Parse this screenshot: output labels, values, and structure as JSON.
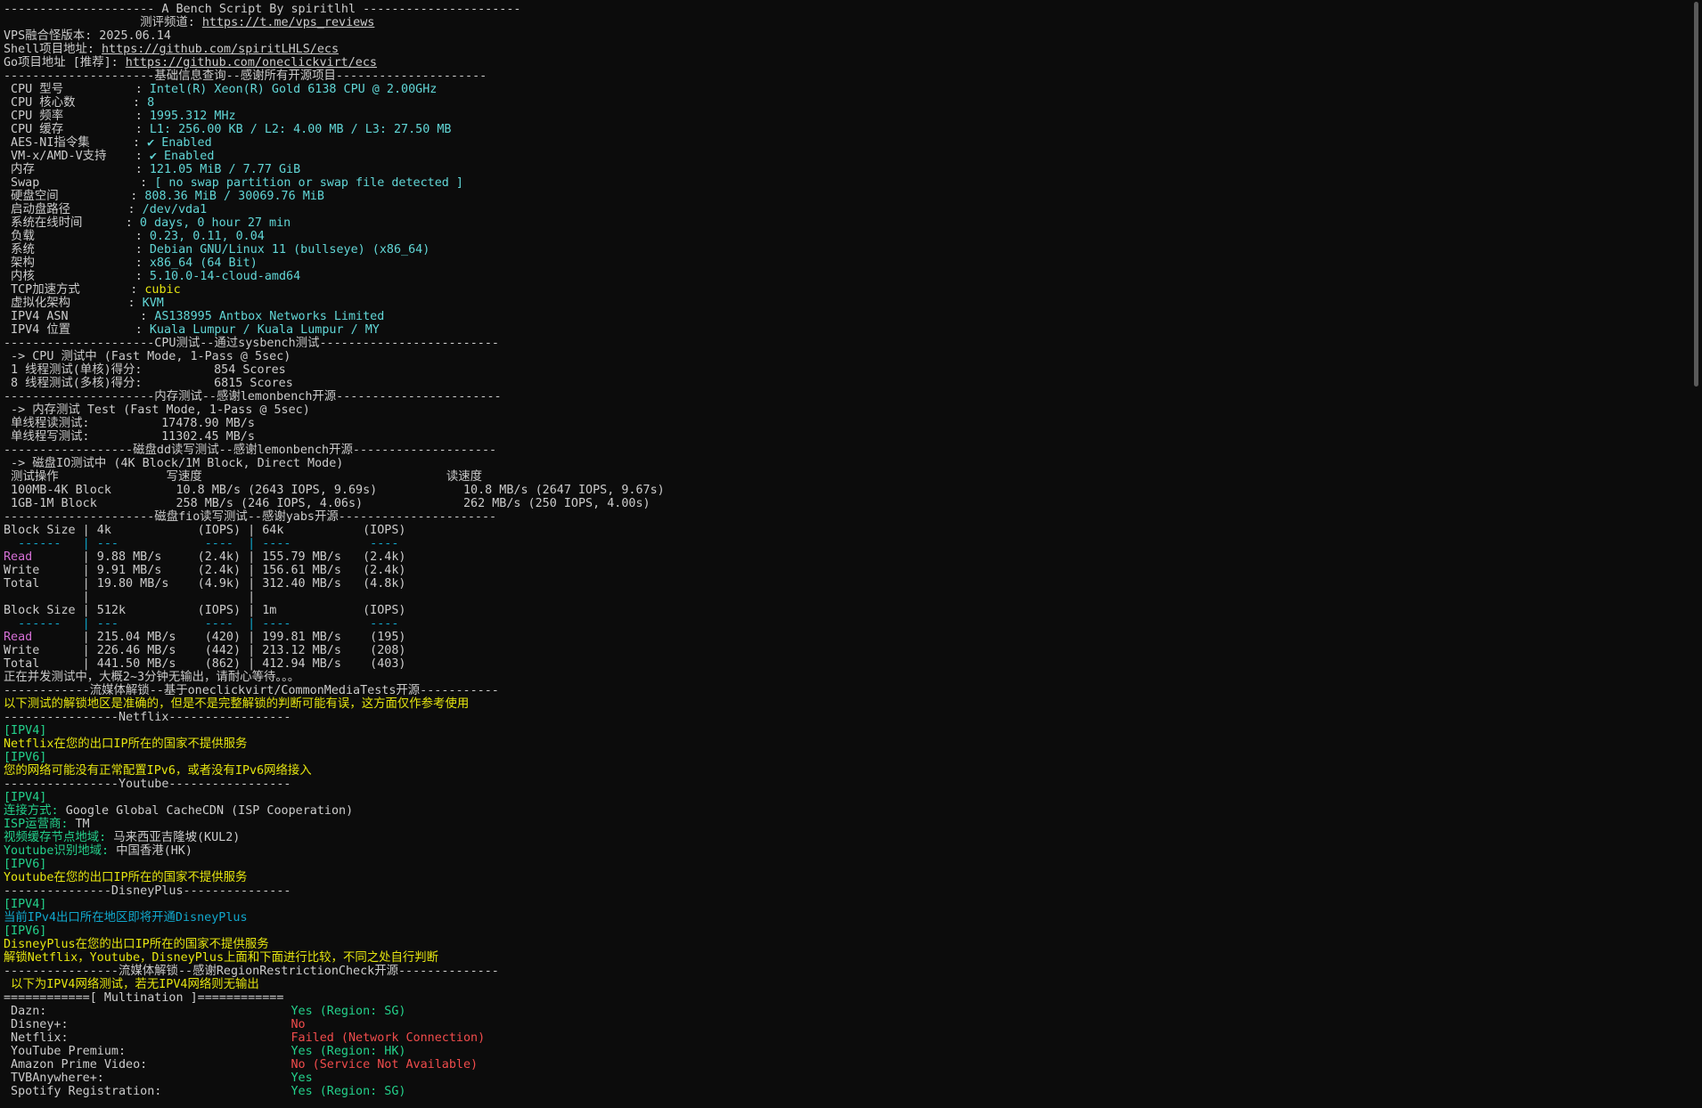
{
  "terminal": {
    "lines": [
      [
        [
          "default",
          "--------------------- A Bench Script By spiritlhl ----------------------"
        ]
      ],
      [
        [
          "default",
          "                   测评频道: "
        ],
        [
          "link",
          "https://t.me/vps_reviews"
        ]
      ],
      [
        [
          "default",
          "VPS融合怪版本: 2025.06.14"
        ]
      ],
      [
        [
          "default",
          "Shell项目地址: "
        ],
        [
          "link",
          "https://github.com/spiritLHLS/ecs"
        ]
      ],
      [
        [
          "default",
          "Go项目地址 [推荐]: "
        ],
        [
          "link",
          "https://github.com/oneclickvirt/ecs"
        ]
      ],
      [
        [
          "default",
          "---------------------基础信息查询--感谢所有开源项目---------------------"
        ]
      ],
      [
        [
          "default",
          " CPU 型号          : "
        ],
        [
          "cyan",
          "Intel(R) Xeon(R) Gold 6138 CPU @ 2.00GHz"
        ]
      ],
      [
        [
          "default",
          " CPU 核心数        : "
        ],
        [
          "cyan",
          "8"
        ]
      ],
      [
        [
          "default",
          " CPU 频率          : "
        ],
        [
          "cyan",
          "1995.312 MHz"
        ]
      ],
      [
        [
          "default",
          " CPU 缓存          : "
        ],
        [
          "cyan",
          "L1: 256.00 KB / L2: 4.00 MB / L3: 27.50 MB"
        ]
      ],
      [
        [
          "default",
          " AES-NI指令集      : "
        ],
        [
          "cyan",
          "✔ Enabled"
        ]
      ],
      [
        [
          "default",
          " VM-x/AMD-V支持    : "
        ],
        [
          "cyan",
          "✔ Enabled"
        ]
      ],
      [
        [
          "default",
          " 内存              : "
        ],
        [
          "cyan",
          "121.05 MiB / 7.77 GiB"
        ]
      ],
      [
        [
          "default",
          " Swap              : "
        ],
        [
          "cyan",
          "[ no swap partition or swap file detected ]"
        ]
      ],
      [
        [
          "default",
          " 硬盘空间          : "
        ],
        [
          "cyan",
          "808.36 MiB / 30069.76 MiB"
        ]
      ],
      [
        [
          "default",
          " 启动盘路径        : "
        ],
        [
          "cyan",
          "/dev/vda1"
        ]
      ],
      [
        [
          "default",
          " 系统在线时间      : "
        ],
        [
          "cyan",
          "0 days, 0 hour 27 min"
        ]
      ],
      [
        [
          "default",
          " 负载              : "
        ],
        [
          "cyan",
          "0.23, 0.11, 0.04"
        ]
      ],
      [
        [
          "default",
          " 系统              : "
        ],
        [
          "cyan",
          "Debian GNU/Linux 11 (bullseye) (x86_64)"
        ]
      ],
      [
        [
          "default",
          " 架构              : "
        ],
        [
          "cyan",
          "x86_64 (64 Bit)"
        ]
      ],
      [
        [
          "default",
          " 内核              : "
        ],
        [
          "cyan",
          "5.10.0-14-cloud-amd64"
        ]
      ],
      [
        [
          "default",
          " TCP加速方式       : "
        ],
        [
          "yellow",
          "cubic"
        ]
      ],
      [
        [
          "default",
          " 虚拟化架构        : "
        ],
        [
          "cyan",
          "KVM"
        ]
      ],
      [
        [
          "default",
          " IPV4 ASN          : "
        ],
        [
          "cyan",
          "AS138995 Antbox Networks Limited"
        ]
      ],
      [
        [
          "default",
          " IPV4 位置         : "
        ],
        [
          "cyan",
          "Kuala Lumpur / Kuala Lumpur / MY"
        ]
      ],
      [
        [
          "default",
          "---------------------CPU测试--通过sysbench测试-------------------------"
        ]
      ],
      [
        [
          "default",
          " -> CPU 测试中 (Fast Mode, 1-Pass @ 5sec)"
        ]
      ],
      [
        [
          "default",
          " 1 线程测试(单核)得分:          854 Scores"
        ]
      ],
      [
        [
          "default",
          " 8 线程测试(多核)得分:          6815 Scores"
        ]
      ],
      [
        [
          "default",
          "---------------------内存测试--感谢lemonbench开源-----------------------"
        ]
      ],
      [
        [
          "default",
          " -> 内存测试 Test (Fast Mode, 1-Pass @ 5sec)"
        ]
      ],
      [
        [
          "default",
          " 单线程读测试:          17478.90 MB/s"
        ]
      ],
      [
        [
          "default",
          " 单线程写测试:          11302.45 MB/s"
        ]
      ],
      [
        [
          "default",
          "------------------磁盘dd读写测试--感谢lemonbench开源--------------------"
        ]
      ],
      [
        [
          "default",
          " -> 磁盘IO测试中 (4K Block/1M Block, Direct Mode)"
        ]
      ],
      [
        [
          "default",
          " 测试操作               写速度                                  读速度"
        ]
      ],
      [
        [
          "default",
          " 100MB-4K Block         10.8 MB/s (2643 IOPS, 9.69s)            10.8 MB/s (2647 IOPS, 9.67s)"
        ]
      ],
      [
        [
          "default",
          " 1GB-1M Block           258 MB/s (246 IOPS, 4.06s)              262 MB/s (250 IOPS, 4.00s)"
        ]
      ],
      [
        [
          "default",
          "---------------------磁盘fio读写测试--感谢yabs开源----------------------"
        ]
      ],
      [
        [
          "default",
          "Block Size | 4k            (IOPS) | 64k           (IOPS)"
        ]
      ],
      [
        [
          "teal",
          "  ------   | ---            ----  | ----           ---- "
        ]
      ],
      [
        [
          "magenta",
          "Read"
        ],
        [
          "default",
          "       | 9.88 MB/s     (2.4k) | 155.79 MB/s   (2.4k)"
        ]
      ],
      [
        [
          "default",
          "Write      | 9.91 MB/s     (2.4k) | 156.61 MB/s   (2.4k)"
        ]
      ],
      [
        [
          "default",
          "Total      | 19.80 MB/s    (4.9k) | 312.40 MB/s   (4.8k)"
        ]
      ],
      [
        [
          "default",
          "           |                      |                     "
        ]
      ],
      [
        [
          "default",
          "Block Size | 512k          (IOPS) | 1m            (IOPS)"
        ]
      ],
      [
        [
          "teal",
          "  ------   | ---            ----  | ----           ---- "
        ]
      ],
      [
        [
          "magenta",
          "Read"
        ],
        [
          "default",
          "       | 215.04 MB/s    (420) | 199.81 MB/s    (195)"
        ]
      ],
      [
        [
          "default",
          "Write      | 226.46 MB/s    (442) | 213.12 MB/s    (208)"
        ]
      ],
      [
        [
          "default",
          "Total      | 441.50 MB/s    (862) | 412.94 MB/s    (403)"
        ]
      ],
      [
        [
          "default",
          "正在并发测试中，大概2~3分钟无输出，请耐心等待。。。"
        ]
      ],
      [
        [
          "default",
          "------------流媒体解锁--基于oneclickvirt/CommonMediaTests开源-----------"
        ]
      ],
      [
        [
          "yellow",
          "以下测试的解锁地区是准确的，但是不是完整解锁的判断可能有误，这方面仅作参考使用"
        ]
      ],
      [
        [
          "default",
          "----------------Netflix-----------------"
        ]
      ],
      [
        [
          "green",
          "[IPV4]"
        ]
      ],
      [
        [
          "yellow",
          "Netflix在您的出口IP所在的国家不提供服务"
        ]
      ],
      [
        [
          "green",
          "[IPV6]"
        ]
      ],
      [
        [
          "yellow",
          "您的网络可能没有正常配置IPv6，或者没有IPv6网络接入"
        ]
      ],
      [
        [
          "default",
          "----------------Youtube-----------------"
        ]
      ],
      [
        [
          "green",
          "[IPV4]"
        ]
      ],
      [
        [
          "green",
          "连接方式: "
        ],
        [
          "default",
          "Google Global CacheCDN (ISP Cooperation)"
        ]
      ],
      [
        [
          "green",
          "ISP运营商: "
        ],
        [
          "default",
          "TM"
        ]
      ],
      [
        [
          "green",
          "视频缓存节点地域: "
        ],
        [
          "default",
          "马来西亚吉隆坡(KUL2)"
        ]
      ],
      [
        [
          "green",
          "Youtube识别地域: "
        ],
        [
          "default",
          "中国香港(HK)"
        ]
      ],
      [
        [
          "green",
          "[IPV6]"
        ]
      ],
      [
        [
          "yellow",
          "Youtube在您的出口IP所在的国家不提供服务"
        ]
      ],
      [
        [
          "default",
          "---------------DisneyPlus---------------"
        ]
      ],
      [
        [
          "green",
          "[IPV4]"
        ]
      ],
      [
        [
          "teal",
          "当前IPv4出口所在地区即将开通DisneyPlus"
        ]
      ],
      [
        [
          "green",
          "[IPV6]"
        ]
      ],
      [
        [
          "yellow",
          "DisneyPlus在您的出口IP所在的国家不提供服务"
        ]
      ],
      [
        [
          "yellow",
          "解锁Netflix，Youtube，DisneyPlus上面和下面进行比较，不同之处自行判断"
        ]
      ],
      [
        [
          "default",
          "----------------流媒体解锁--感谢RegionRestrictionCheck开源--------------"
        ]
      ],
      [
        [
          "yellow",
          " 以下为IPV4网络测试，若无IPV4网络则无输出"
        ]
      ],
      [
        [
          "default",
          "============[ Multination ]============"
        ]
      ],
      [
        [
          "default",
          " Dazn:                                  "
        ],
        [
          "green",
          "Yes (Region: SG)"
        ]
      ],
      [
        [
          "default",
          " Disney+:                               "
        ],
        [
          "red",
          "No"
        ]
      ],
      [
        [
          "default",
          " Netflix:                               "
        ],
        [
          "red",
          "Failed (Network Connection)"
        ]
      ],
      [
        [
          "default",
          " YouTube Premium:                       "
        ],
        [
          "green",
          "Yes (Region: HK)"
        ]
      ],
      [
        [
          "default",
          " Amazon Prime Video:                    "
        ],
        [
          "red",
          "No (Service Not Available)"
        ]
      ],
      [
        [
          "default",
          " TVBAnywhere+:                          "
        ],
        [
          "green",
          "Yes"
        ]
      ],
      [
        [
          "default",
          " Spotify Registration:                  "
        ],
        [
          "green",
          "Yes (Region: SG)"
        ]
      ]
    ]
  }
}
